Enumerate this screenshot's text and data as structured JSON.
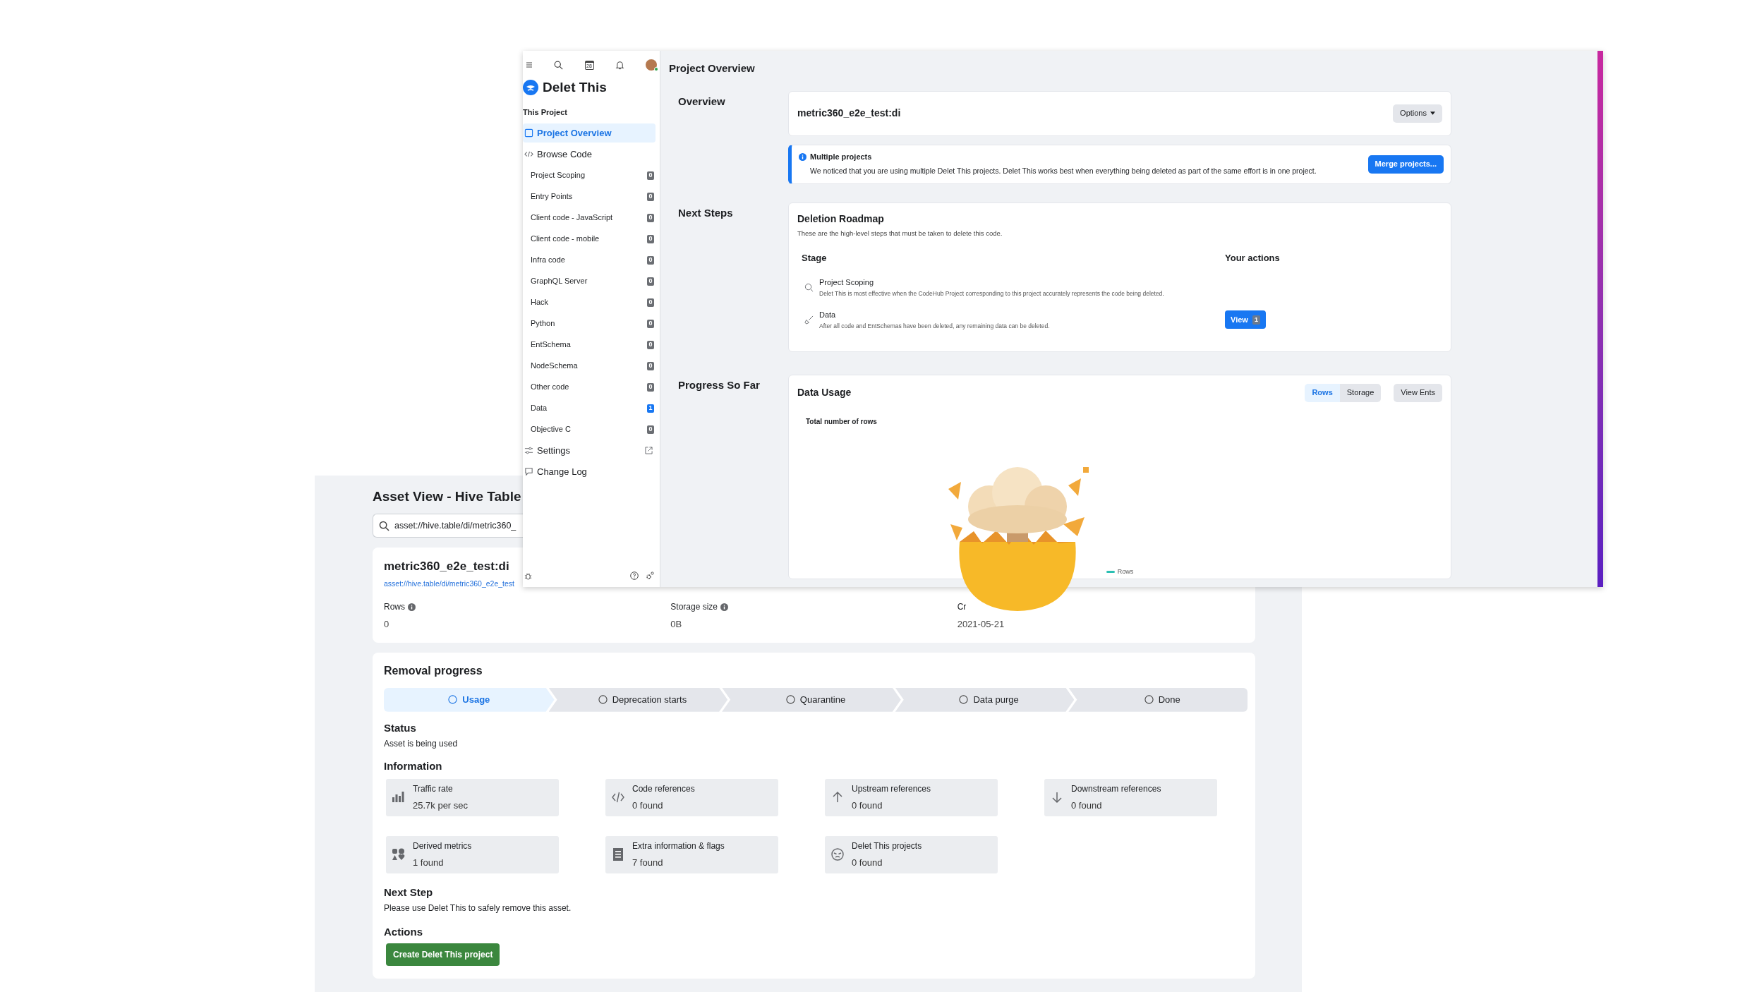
{
  "asset_window": {
    "title": "Asset View - Hive Table",
    "search": {
      "value": "asset://hive.table/di/metric360_"
    },
    "asset": {
      "name": "metric360_e2e_test:di",
      "link": "asset://hive.table/di/metric360_e2e_test",
      "stats": [
        {
          "label": "Rows",
          "info": true,
          "value": "0"
        },
        {
          "label": "Storage size",
          "info": true,
          "value": "0B"
        },
        {
          "label": "Cr",
          "info": false,
          "value": "2021-05-21"
        }
      ]
    },
    "removal": {
      "title": "Removal progress",
      "steps": [
        {
          "label": "Usage",
          "selected": true
        },
        {
          "label": "Deprecation starts",
          "selected": false
        },
        {
          "label": "Quarantine",
          "selected": false
        },
        {
          "label": "Data purge",
          "selected": false
        },
        {
          "label": "Done",
          "selected": false
        }
      ],
      "status": {
        "title": "Status",
        "text": "Asset is being used"
      },
      "information": {
        "title": "Information",
        "items": [
          {
            "label": "Traffic rate",
            "value": "25.7k per sec"
          },
          {
            "label": "Code references",
            "value": "0 found"
          },
          {
            "label": "Upstream references",
            "value": "0 found"
          },
          {
            "label": "Downstream references",
            "value": "0 found"
          },
          {
            "label": "Derived metrics",
            "value": "1 found"
          },
          {
            "label": "Extra information & flags",
            "value": "7 found"
          },
          {
            "label": "Delet This projects",
            "value": "0 found"
          }
        ]
      },
      "next_step": {
        "title": "Next Step",
        "text": "Please use Delet This to safely remove this asset."
      },
      "actions": {
        "title": "Actions",
        "button": "Create Delet This project"
      }
    }
  },
  "project_window": {
    "calendar_day": "28",
    "app_title": "Delet This",
    "section_title": "This Project",
    "sidebar": [
      {
        "kind": "nav",
        "label": "Project Overview",
        "selected": true
      },
      {
        "kind": "nav",
        "label": "Browse Code",
        "selected": false
      },
      {
        "kind": "sub",
        "label": "Project Scoping",
        "count": "0",
        "color": "#6b6e73"
      },
      {
        "kind": "sub",
        "label": "Entry Points",
        "count": "0",
        "color": "#6b6e73"
      },
      {
        "kind": "sub",
        "label": "Client code - JavaScript",
        "count": "0",
        "color": "#6b6e73"
      },
      {
        "kind": "sub",
        "label": "Client code - mobile",
        "count": "0",
        "color": "#6b6e73"
      },
      {
        "kind": "sub",
        "label": "Infra code",
        "count": "0",
        "color": "#6b6e73"
      },
      {
        "kind": "sub",
        "label": "GraphQL Server",
        "count": "0",
        "color": "#6b6e73"
      },
      {
        "kind": "sub",
        "label": "Hack",
        "count": "0",
        "color": "#6b6e73"
      },
      {
        "kind": "sub",
        "label": "Python",
        "count": "0",
        "color": "#6b6e73"
      },
      {
        "kind": "sub",
        "label": "EntSchema",
        "count": "0",
        "color": "#6b6e73"
      },
      {
        "kind": "sub",
        "label": "NodeSchema",
        "count": "0",
        "color": "#6b6e73"
      },
      {
        "kind": "sub",
        "label": "Other code",
        "count": "0",
        "color": "#6b6e73"
      },
      {
        "kind": "sub",
        "label": "Data",
        "count": "1",
        "color": "#1877f2"
      },
      {
        "kind": "sub",
        "label": "Objective C",
        "count": "0",
        "color": "#6b6e73"
      },
      {
        "kind": "nav",
        "label": "Settings",
        "selected": false
      },
      {
        "kind": "nav",
        "label": "Change Log",
        "selected": false
      }
    ],
    "page_title": "Project Overview",
    "overview": {
      "label": "Overview",
      "name": "metric360_e2e_test:di",
      "options": "Options",
      "alert": {
        "title": "Multiple projects",
        "text": "We noticed that you are using multiple Delet This projects. Delet This works best when everything being deleted as part of the same effort is in one project.",
        "button": "Merge projects..."
      }
    },
    "next_steps": {
      "label": "Next Steps",
      "title": "Deletion Roadmap",
      "subtitle": "These are the high-level steps that must be taken to delete this code.",
      "stage_header": "Stage",
      "actions_header": "Your actions",
      "rows": [
        {
          "name": "Project Scoping",
          "description": "Delet This is most effective when the CodeHub Project corresponding to this project accurately represents the code being deleted."
        },
        {
          "name": "Data",
          "description": "After all code and EntSchemas have been deleted, any remaining data can be deleted.",
          "action": {
            "label": "View",
            "count": "1"
          }
        }
      ]
    },
    "progress": {
      "label": "Progress So Far",
      "title": "Data Usage",
      "tabs": [
        {
          "label": "Rows",
          "selected": true
        },
        {
          "label": "Storage",
          "selected": false
        }
      ],
      "button": "View Ents",
      "chart_title": "Total number of rows",
      "legend": "Rows"
    }
  }
}
